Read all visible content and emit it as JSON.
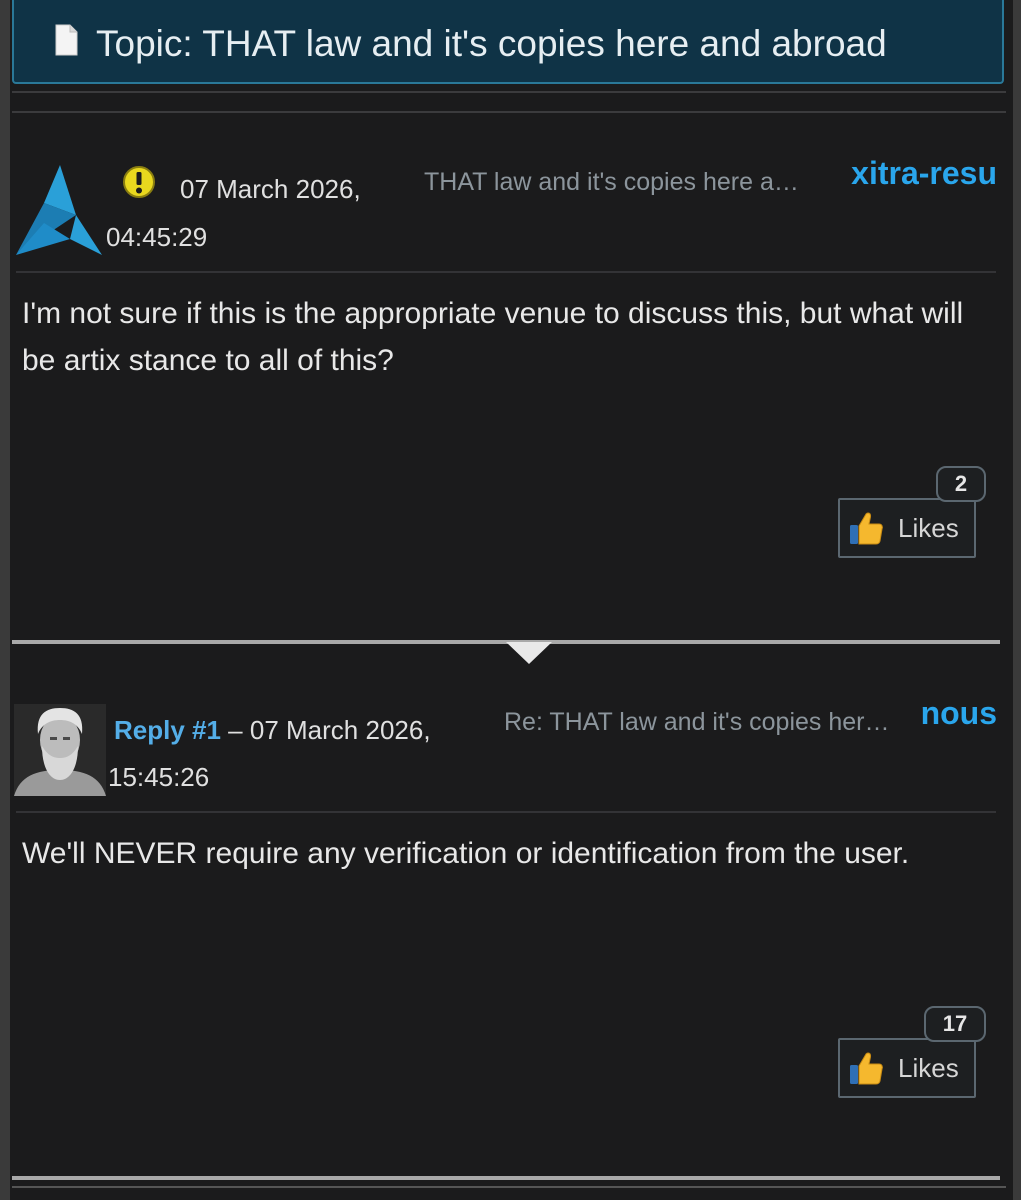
{
  "topic": {
    "title": "Topic: THAT law and it's copies here and abroad",
    "icon": "document-icon"
  },
  "posts": [
    {
      "avatar": "triangle-logo-avatar",
      "status_icon": "warning-icon",
      "prefix": "",
      "date": "07 March 2026,",
      "time": "04:45:29",
      "subject": "THAT law and it's copies here a…",
      "username": "xitra-resu",
      "body": "I'm not sure if this is the appropriate venue to discuss this, but what will be artix stance to all of this?",
      "likes_label": "Likes",
      "likes_count": "2"
    },
    {
      "avatar": "statue-bust-avatar",
      "prefix": "Reply #1",
      "dash": " – ",
      "date": "07 March 2026,",
      "time": "15:45:26",
      "subject": "Re: THAT law and it's copies her…",
      "username": "nous",
      "body": "We'll NEVER require any verification or identification from the user.",
      "likes_label": "Likes",
      "likes_count": "17"
    }
  ],
  "colors": {
    "background": "#1b1b1c",
    "header_bg": "#0f3346",
    "header_border": "#2a7898",
    "username": "#2aa6ec",
    "reply_link": "#54aee8",
    "subject": "#8c959c"
  }
}
